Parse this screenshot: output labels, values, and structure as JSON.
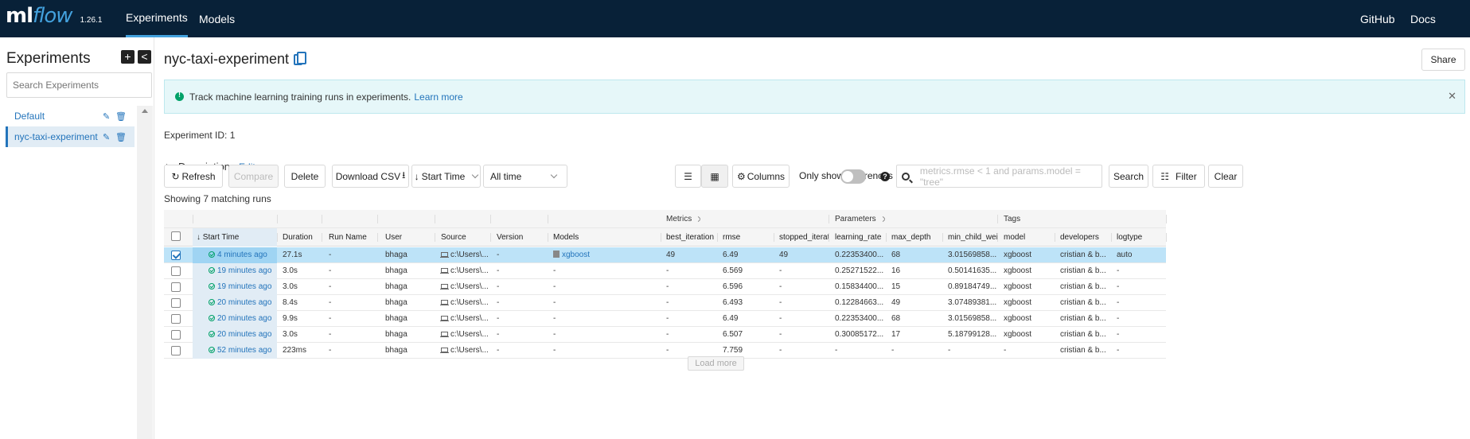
{
  "header": {
    "logo_ml": "ml",
    "logo_flow": "flow",
    "version": "1.26.1",
    "nav": {
      "experiments": "Experiments",
      "models": "Models",
      "github": "GitHub",
      "docs": "Docs"
    }
  },
  "sidebar": {
    "title": "Experiments",
    "add_icon": "+",
    "collapse_icon": "<",
    "search_placeholder": "Search Experiments",
    "items": [
      {
        "label": "Default"
      },
      {
        "label": "nyc-taxi-experiment"
      }
    ]
  },
  "main": {
    "title": "nyc-taxi-experiment",
    "share": "Share",
    "banner_text": "Track machine learning training runs in experiments.",
    "banner_link": "Learn more",
    "experiment_id_label": "Experiment ID:",
    "experiment_id": "1",
    "description_label": "Description",
    "description_edit": "Edit",
    "toolbar": {
      "refresh": "Refresh",
      "compare": "Compare",
      "delete": "Delete",
      "download_csv": "Download CSV",
      "sort": "Start Time",
      "time_range": "All time",
      "columns": "Columns",
      "only_diff": "Only show differences",
      "search_placeholder": "metrics.rmse < 1 and params.model = \"tree\"",
      "search": "Search",
      "filter": "Filter",
      "clear": "Clear"
    },
    "showing": "Showing 7 matching runs",
    "load_more": "Load more"
  },
  "table": {
    "groups": {
      "metrics": "Metrics",
      "parameters": "Parameters",
      "tags": "Tags"
    },
    "columns": [
      "Start Time",
      "Duration",
      "Run Name",
      "User",
      "Source",
      "Version",
      "Models",
      "best_iteration",
      "rmse",
      "stopped_iteratic",
      "learning_rate",
      "max_depth",
      "min_child_weigh",
      "model",
      "developers",
      "logtype"
    ],
    "rows": [
      {
        "selected": true,
        "start": "4 minutes ago",
        "duration": "27.1s",
        "run_name": "-",
        "user": "bhaga",
        "source": "c:\\Users\\...",
        "version": "-",
        "models": "xgboost",
        "best_iteration": "49",
        "rmse": "6.49",
        "stopped": "49",
        "learning_rate": "0.22353400...",
        "max_depth": "68",
        "min_child": "3.01569858...",
        "model": "xgboost",
        "developers": "cristian & b...",
        "logtype": "auto"
      },
      {
        "selected": false,
        "start": "19 minutes ago",
        "duration": "3.0s",
        "run_name": "-",
        "user": "bhaga",
        "source": "c:\\Users\\...",
        "version": "-",
        "models": "-",
        "best_iteration": "-",
        "rmse": "6.569",
        "stopped": "-",
        "learning_rate": "0.25271522...",
        "max_depth": "16",
        "min_child": "0.50141635...",
        "model": "xgboost",
        "developers": "cristian & b...",
        "logtype": "-"
      },
      {
        "selected": false,
        "start": "19 minutes ago",
        "duration": "3.0s",
        "run_name": "-",
        "user": "bhaga",
        "source": "c:\\Users\\...",
        "version": "-",
        "models": "-",
        "best_iteration": "-",
        "rmse": "6.596",
        "stopped": "-",
        "learning_rate": "0.15834400...",
        "max_depth": "15",
        "min_child": "0.89184749...",
        "model": "xgboost",
        "developers": "cristian & b...",
        "logtype": "-"
      },
      {
        "selected": false,
        "start": "20 minutes ago",
        "duration": "8.4s",
        "run_name": "-",
        "user": "bhaga",
        "source": "c:\\Users\\...",
        "version": "-",
        "models": "-",
        "best_iteration": "-",
        "rmse": "6.493",
        "stopped": "-",
        "learning_rate": "0.12284663...",
        "max_depth": "49",
        "min_child": "3.07489381...",
        "model": "xgboost",
        "developers": "cristian & b...",
        "logtype": "-"
      },
      {
        "selected": false,
        "start": "20 minutes ago",
        "duration": "9.9s",
        "run_name": "-",
        "user": "bhaga",
        "source": "c:\\Users\\...",
        "version": "-",
        "models": "-",
        "best_iteration": "-",
        "rmse": "6.49",
        "stopped": "-",
        "learning_rate": "0.22353400...",
        "max_depth": "68",
        "min_child": "3.01569858...",
        "model": "xgboost",
        "developers": "cristian & b...",
        "logtype": "-"
      },
      {
        "selected": false,
        "start": "20 minutes ago",
        "duration": "3.0s",
        "run_name": "-",
        "user": "bhaga",
        "source": "c:\\Users\\...",
        "version": "-",
        "models": "-",
        "best_iteration": "-",
        "rmse": "6.507",
        "stopped": "-",
        "learning_rate": "0.30085172...",
        "max_depth": "17",
        "min_child": "5.18799128...",
        "model": "xgboost",
        "developers": "cristian & b...",
        "logtype": "-"
      },
      {
        "selected": false,
        "start": "52 minutes ago",
        "duration": "223ms",
        "run_name": "-",
        "user": "bhaga",
        "source": "c:\\Users\\...",
        "version": "-",
        "models": "-",
        "best_iteration": "-",
        "rmse": "7.759",
        "stopped": "-",
        "learning_rate": "-",
        "max_depth": "-",
        "min_child": "-",
        "model": "-",
        "developers": "cristian & b...",
        "logtype": "-"
      }
    ]
  },
  "colors": {
    "header_bg": "#082138",
    "accent": "#2374bb",
    "logo_flow": "#43a1dd",
    "selected_row": "#bde3f8"
  }
}
